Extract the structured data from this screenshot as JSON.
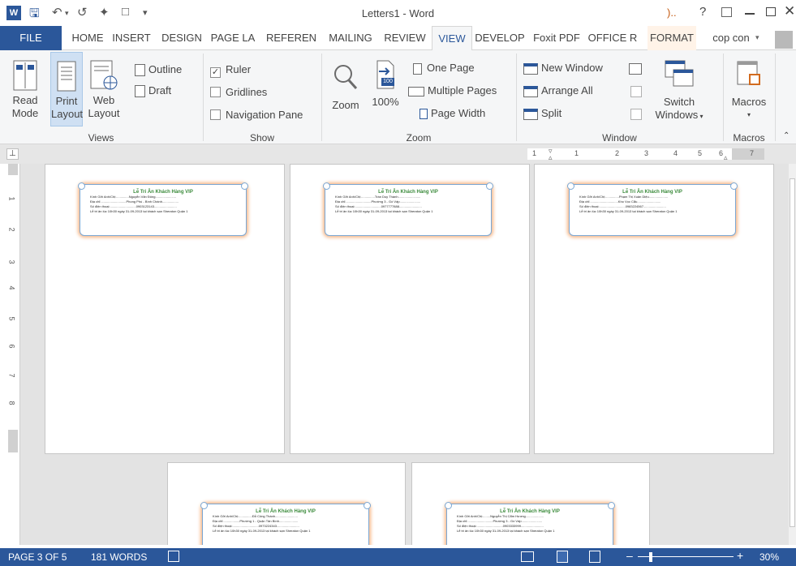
{
  "window": {
    "title": "Letters1 - Word",
    "help_label": "?"
  },
  "tabs": [
    {
      "label": "FILE"
    },
    {
      "label": "HOME"
    },
    {
      "label": "INSERT"
    },
    {
      "label": "DESIGN"
    },
    {
      "label": "PAGE LA"
    },
    {
      "label": "REFEREN"
    },
    {
      "label": "MAILING"
    },
    {
      "label": "REVIEW"
    },
    {
      "label": "VIEW"
    },
    {
      "label": "DEVELOP"
    },
    {
      "label": "Foxit PDF"
    },
    {
      "label": "OFFICE R"
    },
    {
      "label": "FORMAT"
    }
  ],
  "user": {
    "name": "cop con"
  },
  "ribbon": {
    "views": {
      "label": "Views",
      "read_mode": [
        "Read",
        "Mode"
      ],
      "print_layout": [
        "Print",
        "Layout"
      ],
      "web_layout": [
        "Web",
        "Layout"
      ],
      "outline": "Outline",
      "draft": "Draft"
    },
    "show": {
      "label": "Show",
      "ruler": "Ruler",
      "gridlines": "Gridlines",
      "navigation_pane": "Navigation Pane",
      "ruler_checked": true
    },
    "zoom": {
      "label": "Zoom",
      "zoom": "Zoom",
      "hundred": "100%",
      "hundred_badge": "100",
      "one_page": "One Page",
      "multiple_pages": "Multiple Pages",
      "page_width": "Page Width"
    },
    "window": {
      "label": "Window",
      "new_window": "New Window",
      "arrange_all": "Arrange All",
      "split": "Split",
      "switch_windows": [
        "Switch",
        "Windows"
      ]
    },
    "macros": {
      "label": "Macros",
      "button": "Macros"
    }
  },
  "ruler": {
    "ticks": [
      "1",
      "1",
      "2",
      "3",
      "4",
      "5",
      "6",
      "7"
    ],
    "vticks": [
      "1",
      "2",
      "3",
      "4",
      "5",
      "6",
      "7",
      "8"
    ]
  },
  "letters": [
    {
      "title": "Lễ Tri Ân Khách Hàng VIP",
      "line1": "Kính Gởi Anh/Chị:..............Nguyễn Văn Đông.......................",
      "line2": "Địa chỉ:............................Phong Phú - Bình Chánh..................",
      "line3": "Số điện thoại:.............................0903123143.........................",
      "line4": "Lễ tri ân lúc 10h30 ngày 31-09-2013 tại khách sạn Sheraton Quận 1"
    },
    {
      "title": "Lễ Tri Ân Khách Hàng VIP",
      "line1": "Kính Gởi Anh/Chị:...............Trần Duy Thành.........................",
      "line2": "Địa chỉ:............................Phường 3 - Gò Vấp.......................",
      "line3": "Số điện thoại:.............................0977777888.........................",
      "line4": "Lễ tri ân lúc 10h30 ngày 31-09-2013 tại khách sạn Sheraton Quận 1"
    },
    {
      "title": "Lễ Tri Ân Khách Hàng VIP",
      "line1": "Kính Gởi Anh/Chị:...............Phạm Thị Xuân Diệu.....................",
      "line2": "Địa chỉ:...............................Kho Vọc Cẩu..........................",
      "line3": "Số điện thoại:.............................0983224567.........................",
      "line4": "Lễ tri ân lúc 10h30 ngày 31-09-2013 tại khách sạn Sheraton Quận 1"
    },
    {
      "title": "Lễ Tri Ân Khách Hàng VIP",
      "line1": "Kính Gởi Anh/Chị:...............Đỗ Công Thành.........................",
      "line2": "Địa chỉ:..................Phường 1 - Quận Tân Bình.....................",
      "line3": "Số điện thoại:.............................0973224343.........................",
      "line4": "Lễ tri ân lúc 10h30 ngày 31-09-2013 tại khách sạn Sheraton Quận 1"
    },
    {
      "title": "Lễ Tri Ân Khách Hàng VIP",
      "line1": "Kính Gởi Anh/Chị:........Nguyễn Thị Cẩm Hương....................",
      "line2": "Địa chỉ:............................Phường 3 - Gò Vấp.......................",
      "line3": "Số điện thoại:.............................0903333999.........................",
      "line4": "Lễ tri ân lúc 10h30 ngày 31-09-2013 tại khách sạn Sheraton Quận 1"
    }
  ],
  "status": {
    "page": "PAGE 3 OF 5",
    "words": "181 WORDS",
    "zoom": "30%"
  }
}
